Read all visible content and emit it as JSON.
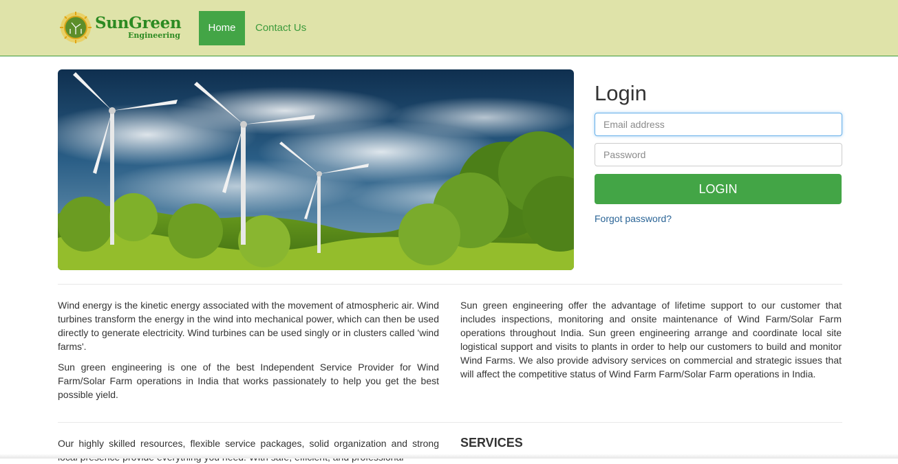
{
  "brand": {
    "name": "SunGreen",
    "tagline": "Engineering"
  },
  "nav": {
    "items": [
      {
        "label": "Home",
        "active": true
      },
      {
        "label": "Contact Us",
        "active": false
      }
    ]
  },
  "login": {
    "title": "Login",
    "email_placeholder": "Email address",
    "password_placeholder": "Password",
    "submit_label": "LOGIN",
    "forgot_label": "Forgot password?"
  },
  "content": {
    "left_paragraphs": [
      "Wind energy is the kinetic energy associated with the movement of atmospheric air. Wind turbines transform the energy in the wind into mechanical power, which can then be used directly to generate electricity. Wind turbines can be used singly or in clusters called 'wind farms'.",
      "Sun green engineering is one of the best Independent Service Provider for Wind Farm/Solar Farm operations in India that works passionately to help you get the best possible yield."
    ],
    "right_paragraph": "Sun green engineering offer the advantage of lifetime support to our customer that includes inspections, monitoring and onsite maintenance of Wind Farm/Solar Farm operations throughout India. Sun green engineering arrange and coordinate local site logistical support and visits to plants in order to help our customers to build and monitor Wind Farms. We also provide advisory services on commercial and strategic issues that will affect the competitive status of Wind Farm Farm/Solar Farm operations in India.",
    "bottom_paragraph": "Our highly skilled resources, flexible service packages, solid organization and strong local presence provide everything you need. With safe, efficient, and professional",
    "services_heading": "SERVICES"
  },
  "colors": {
    "navbar_bg": "#dfe3a9",
    "accent_green": "#43a546",
    "link_blue": "#2a6496"
  },
  "icons": {
    "logo": "sun-turbine-emblem"
  }
}
